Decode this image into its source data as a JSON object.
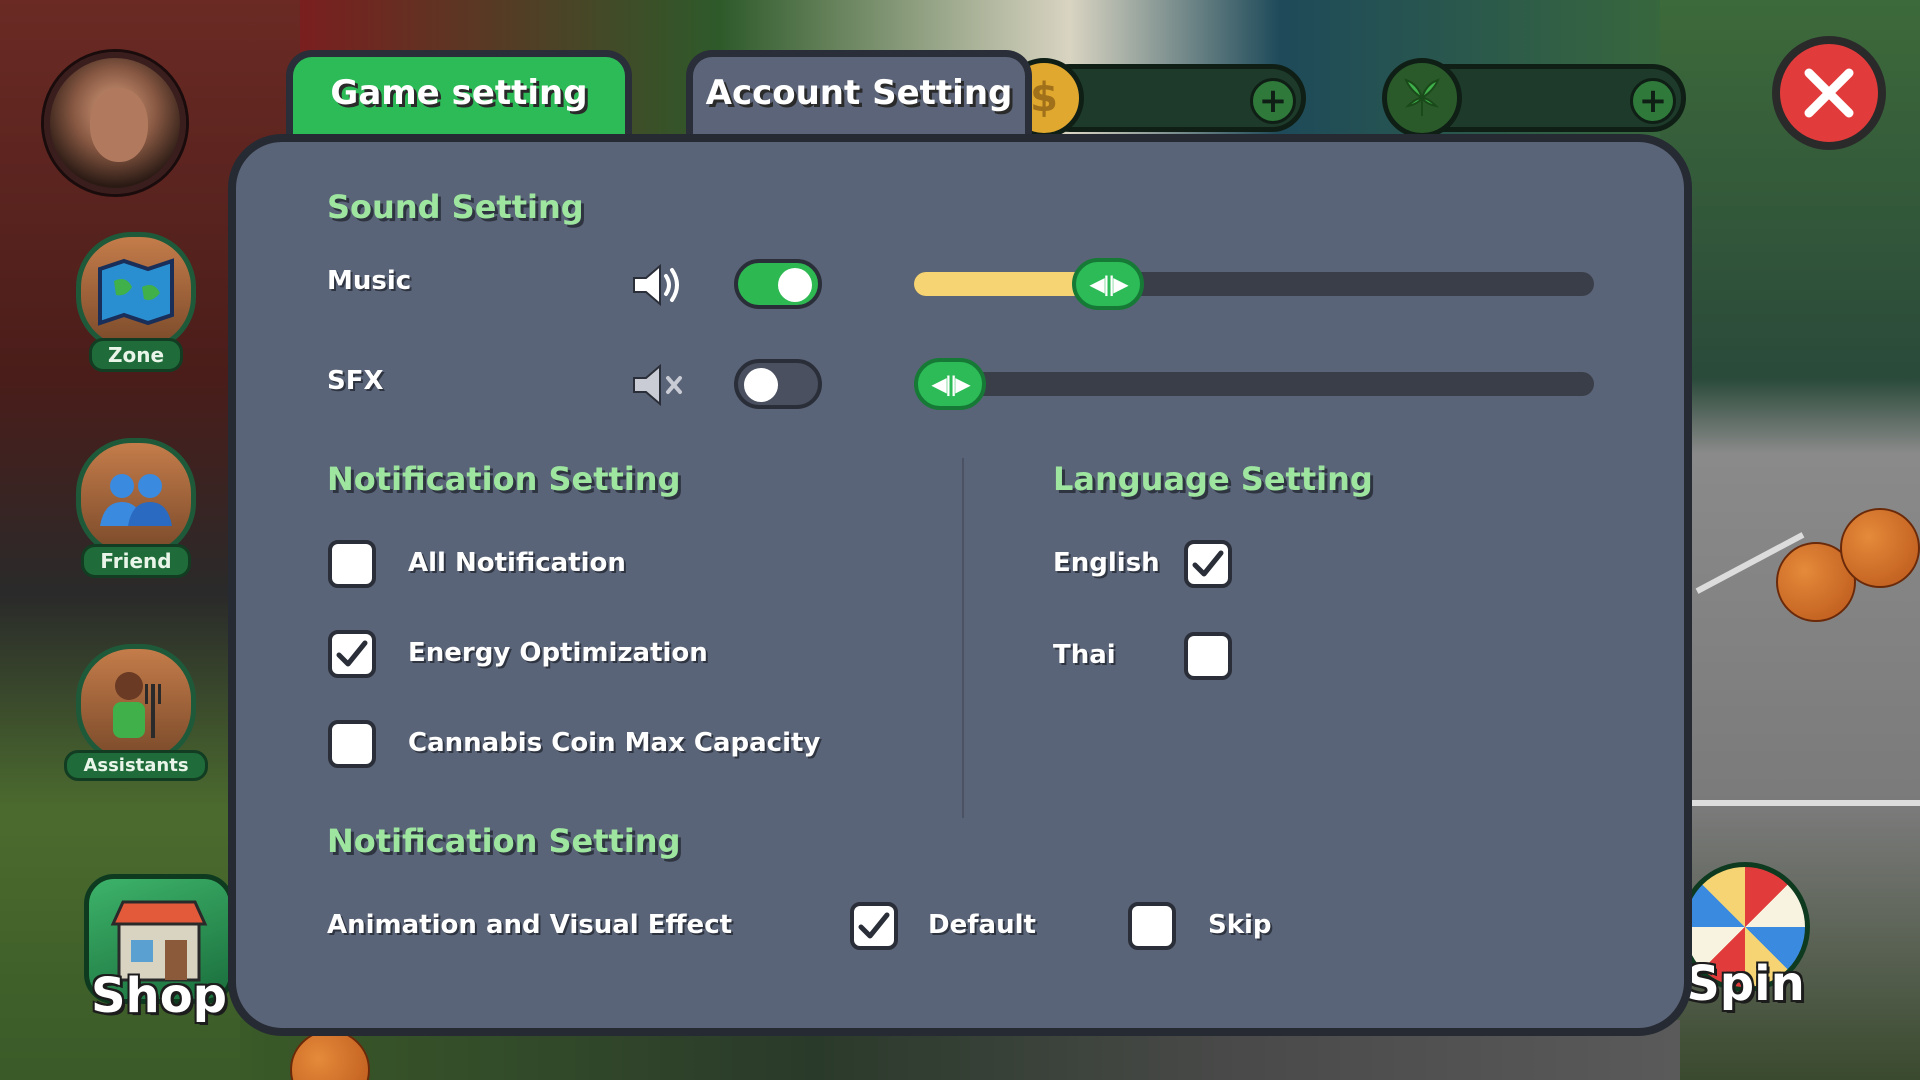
{
  "tabs": {
    "game": "Game setting",
    "account": "Account Setting"
  },
  "sidebar": {
    "zone": "Zone",
    "friend": "Friend",
    "assistants": "Assistants",
    "shop": "Shop",
    "spin": "Spin"
  },
  "sound": {
    "title": "Sound Setting",
    "music_label": "Music",
    "music_on": true,
    "music_level": 0.26,
    "sfx_label": "SFX",
    "sfx_on": false,
    "sfx_level": 0.0
  },
  "notification": {
    "title": "Notification Setting",
    "items": [
      {
        "label": "All Notification",
        "checked": false
      },
      {
        "label": "Energy Optimization",
        "checked": true
      },
      {
        "label": "Cannabis Coin Max Capacity",
        "checked": false
      }
    ]
  },
  "language": {
    "title": "Language Setting",
    "english": "English",
    "english_checked": true,
    "thai": "Thai",
    "thai_checked": false
  },
  "animation": {
    "title": "Notification Setting",
    "label": "Animation and Visual Effect",
    "default_label": "Default",
    "default_checked": true,
    "skip_label": "Skip",
    "skip_checked": false
  },
  "colors": {
    "accent_green": "#2dbb58",
    "title_green": "#9ee6a0",
    "panel": "#5a6478",
    "close_red": "#e23b3b",
    "music_fill": "#f7d473"
  }
}
